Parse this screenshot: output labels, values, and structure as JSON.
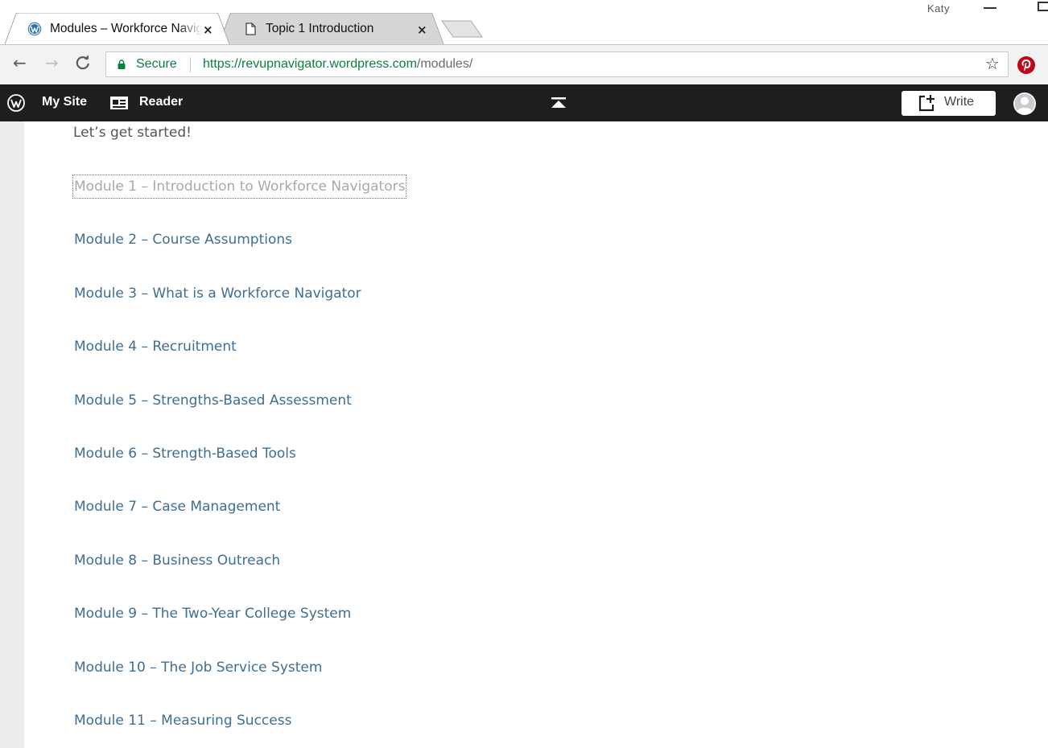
{
  "browser": {
    "tabs": [
      {
        "title": "Modules – Workforce Navigators",
        "close": "×",
        "favicon": "wordpress-icon",
        "active": true
      },
      {
        "title": "Topic 1 Introduction",
        "close": "×",
        "favicon": "page-icon",
        "active": false
      }
    ],
    "window_user": "Katy",
    "address": {
      "secure_label": "Secure",
      "url_host": "https://revupnavigator.wordpress.com",
      "url_path": "/modules/"
    },
    "colors": {
      "secure_green": "#0b8043",
      "pinterest_red": "#bd081c"
    }
  },
  "wp_admin_bar": {
    "my_site": "My Site",
    "reader": "Reader",
    "write": "Write"
  },
  "page": {
    "intro": "Let’s get started!",
    "link_color": "#3e6e93",
    "modules": [
      {
        "label": "Module 1 – Introduction to Workforce Navigators",
        "state": "visited-focused"
      },
      {
        "label": "Module 2 – Course Assumptions"
      },
      {
        "label": "Module 3 – What is a Workforce Navigator"
      },
      {
        "label": "Module 4 – Recruitment"
      },
      {
        "label": "Module 5 – Strengths-Based Assessment"
      },
      {
        "label": "Module 6 – Strength-Based Tools"
      },
      {
        "label": "Module 7 – Case Management"
      },
      {
        "label": "Module 8 – Business Outreach"
      },
      {
        "label": "Module 9 – The Two-Year College System"
      },
      {
        "label": "Module 10 – The Job Service System"
      },
      {
        "label": "Module 11 – Measuring Success"
      }
    ]
  }
}
